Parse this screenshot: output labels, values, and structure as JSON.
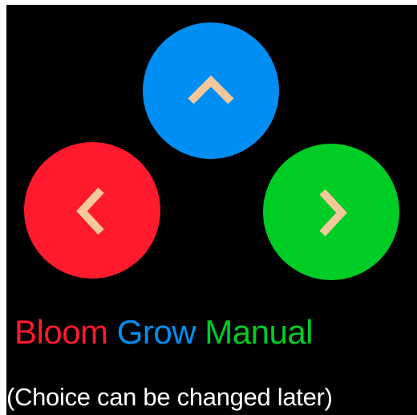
{
  "buttons": {
    "up": {
      "color": "#008ef4",
      "icon": "chevron-up-icon"
    },
    "left": {
      "color": "#ff1a2e",
      "icon": "chevron-left-icon"
    },
    "right": {
      "color": "#00cc26",
      "icon": "chevron-right-icon"
    }
  },
  "chevron_color": "#f4c89a",
  "labels": {
    "bloom": {
      "text": "Bloom",
      "color": "#ff1a2e"
    },
    "grow": {
      "text": "Grow",
      "color": "#008ef4"
    },
    "manual": {
      "text": "Manual",
      "color": "#00cc26"
    }
  },
  "note": {
    "text": "(Choice can be changed later)",
    "color": "#ffffff"
  }
}
